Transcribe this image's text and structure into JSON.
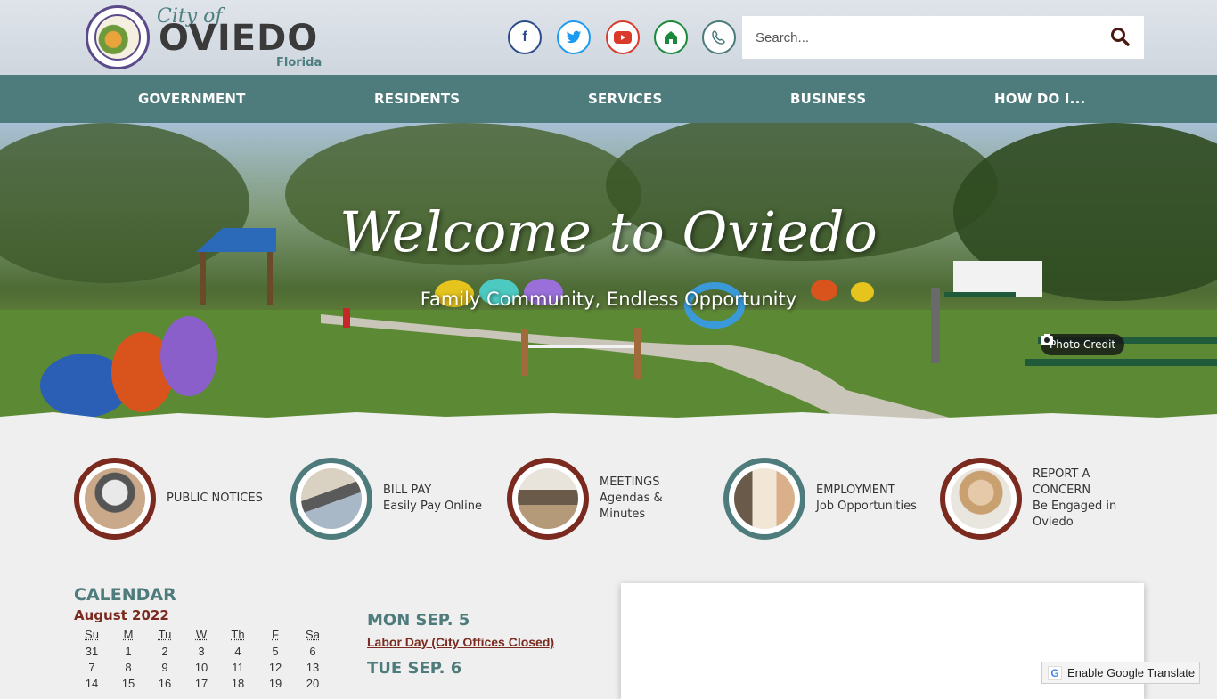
{
  "header": {
    "logo": {
      "city_prefix": "City of",
      "name": "OVIEDO",
      "state": "Florida"
    },
    "social": [
      {
        "name": "facebook",
        "glyph": "f"
      },
      {
        "name": "twitter",
        "glyph": "t"
      },
      {
        "name": "youtube",
        "glyph": "▶"
      },
      {
        "name": "nextdoor",
        "glyph": "⌂"
      },
      {
        "name": "phone",
        "glyph": "✆"
      }
    ],
    "search": {
      "placeholder": "Search..."
    }
  },
  "nav": {
    "items": [
      "GOVERNMENT",
      "RESIDENTS",
      "SERVICES",
      "BUSINESS",
      "HOW DO I..."
    ]
  },
  "hero": {
    "title": "Welcome to Oviedo",
    "subtitle": "Family Community, Endless Opportunity",
    "photo_credit": "Photo Credit"
  },
  "quick_links": [
    {
      "title": "PUBLIC NOTICES",
      "subtitle": "",
      "ring": "red"
    },
    {
      "title": "BILL PAY",
      "subtitle": "Easily Pay Online",
      "ring": "teal"
    },
    {
      "title": "MEETINGS",
      "subtitle": "Agendas & Minutes",
      "ring": "red"
    },
    {
      "title": "EMPLOYMENT",
      "subtitle": "Job Opportunities",
      "ring": "teal"
    },
    {
      "title": "REPORT A CONCERN",
      "subtitle": "Be Engaged in Oviedo",
      "ring": "red"
    }
  ],
  "calendar": {
    "title": "CALENDAR",
    "month": "August 2022",
    "days": [
      "Su",
      "M",
      "Tu",
      "W",
      "Th",
      "F",
      "Sa"
    ],
    "weeks": [
      [
        "31",
        "1",
        "2",
        "3",
        "4",
        "5",
        "6"
      ],
      [
        "7",
        "8",
        "9",
        "10",
        "11",
        "12",
        "13"
      ],
      [
        "14",
        "15",
        "16",
        "17",
        "18",
        "19",
        "20"
      ]
    ]
  },
  "events": [
    {
      "day": "MON SEP. 5",
      "link": "Labor Day (City Offices Closed)"
    },
    {
      "day": "TUE SEP. 6",
      "link": ""
    }
  ],
  "translate": {
    "label": "Enable Google Translate"
  },
  "colors": {
    "teal": "#4e7b7b",
    "maroon": "#7a2a1e"
  }
}
